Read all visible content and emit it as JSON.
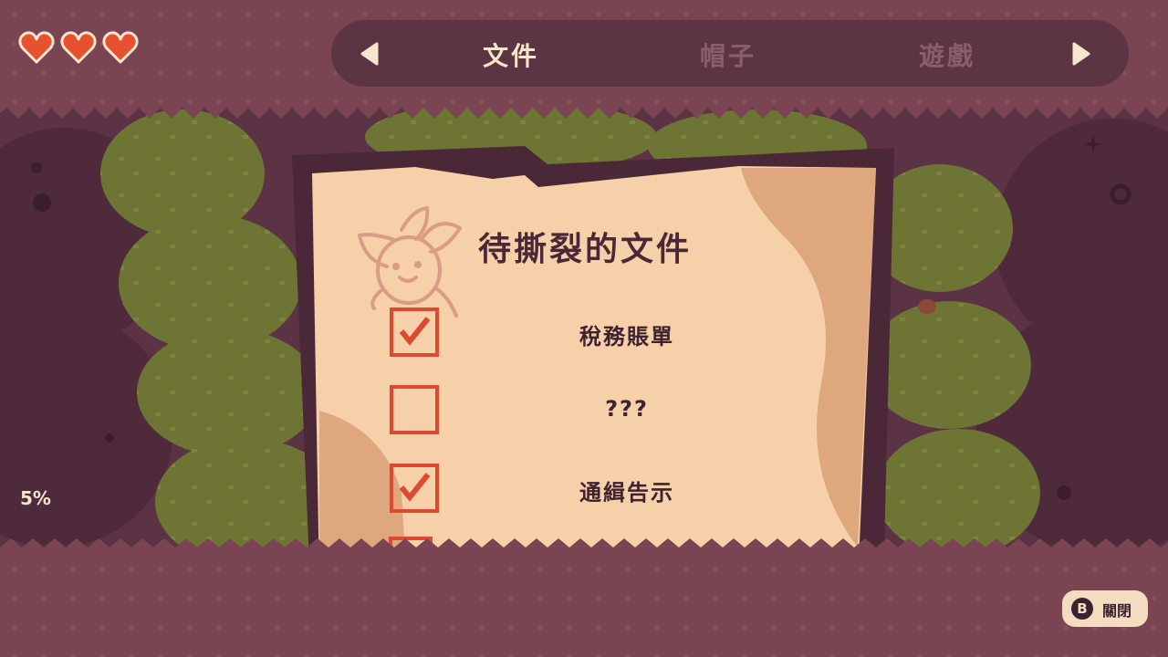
{
  "hud": {
    "hearts": 3,
    "progress_text": "5%",
    "heart_color": "#e8512f"
  },
  "tabs": {
    "items": [
      {
        "label": "文件"
      },
      {
        "label": "帽子"
      },
      {
        "label": "遊戲"
      }
    ],
    "selected": "文件",
    "prev_icon": "arrow-left-icon",
    "next_icon": "arrow-right-icon"
  },
  "document": {
    "title": "待撕裂的文件",
    "tasks": [
      {
        "label": "稅務賬單",
        "checked": true
      },
      {
        "label": "???",
        "checked": false
      },
      {
        "label": "通緝告示",
        "checked": true
      }
    ]
  },
  "close_button": {
    "key": "B",
    "label": "關閉"
  },
  "colors": {
    "frame": "#7a4452",
    "paper": "#f5d0a8",
    "checkbox": "#dd4a32",
    "ink": "#3f2230"
  }
}
